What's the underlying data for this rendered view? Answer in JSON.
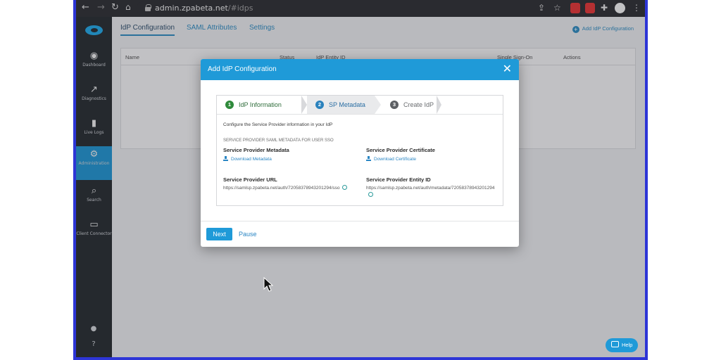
{
  "browser": {
    "url_host": "admin.zpabeta.net",
    "url_path": "/#idps",
    "nav_icons": [
      "back-icon",
      "forward-icon",
      "reload-icon",
      "home-icon"
    ]
  },
  "sidebar": {
    "items": [
      {
        "label": "Dashboard",
        "icon": "dashboard-icon",
        "glyph": "◉",
        "active": false
      },
      {
        "label": "Diagnostics",
        "icon": "diagnostics-icon",
        "glyph": "📈",
        "active": false
      },
      {
        "label": "Live Logs",
        "icon": "live-logs-icon",
        "glyph": "▮",
        "active": false
      },
      {
        "label": "Administration",
        "icon": "gears-icon",
        "glyph": "⚙",
        "active": true
      },
      {
        "label": "Search",
        "icon": "search-icon",
        "glyph": "⌕",
        "active": false
      },
      {
        "label": "Client Connector",
        "icon": "laptop-icon",
        "glyph": "▭",
        "active": false
      }
    ],
    "bottom_icons": [
      "user-icon",
      "help-circle-icon"
    ]
  },
  "tabs": [
    {
      "label": "IdP Configuration",
      "active": true
    },
    {
      "label": "SAML Attributes",
      "active": false
    },
    {
      "label": "Settings",
      "active": false
    }
  ],
  "add_idp_label": "Add IdP Configuration",
  "table": {
    "headers": [
      "Name",
      "Status",
      "IdP Entity ID",
      "Single Sign-On",
      "Actions"
    ]
  },
  "modal": {
    "title": "Add IdP Configuration",
    "close_icon": "close-icon",
    "steps": [
      {
        "number": "1",
        "label": "IdP Information",
        "state": "done"
      },
      {
        "number": "2",
        "label": "SP Metadata",
        "state": "current"
      },
      {
        "number": "3",
        "label": "Create IdP",
        "state": "future"
      }
    ],
    "instruction": "Configure the Service Provider information in your IdP",
    "section_title": "SERVICE PROVIDER SAML METADATA FOR USER SSO",
    "sp_metadata": {
      "label": "Service Provider Metadata",
      "link": "Download Metadata"
    },
    "sp_certificate": {
      "label": "Service Provider Certificate",
      "link": "Download Certificate"
    },
    "sp_url": {
      "label": "Service Provider URL",
      "value": "https://samlsp.zpabeta.net/auth/72058378943201294/sso"
    },
    "sp_entity_id": {
      "label": "Service Provider Entity ID",
      "value": "https://samlsp.zpabeta.net/auth/metadata/72058378943201294"
    },
    "next_label": "Next",
    "pause_label": "Pause"
  },
  "help_label": "Help",
  "colors": {
    "accent": "#1f9ad8",
    "sidebar_bg": "#24292e",
    "step_done": "#2f8a3b",
    "step_current": "#2a82bd"
  }
}
